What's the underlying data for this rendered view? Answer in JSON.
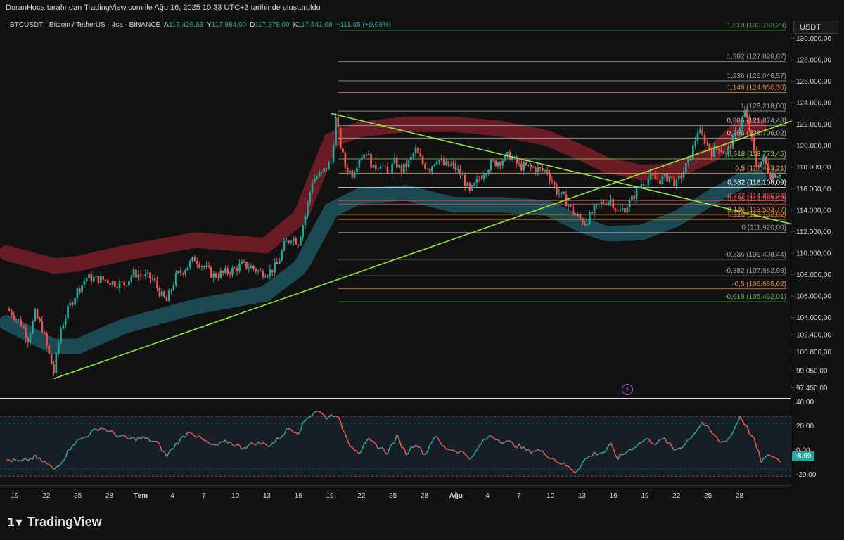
{
  "caption": "DuranHoca tarafından TradingView.com ile Ağu 16, 2025 10:33 UTC+3 tarihinde oluşturuldu",
  "legend": {
    "symbol": "BTCUSDT · Bitcoin / TetherUS · 4sa · BINANCE",
    "o_label": "A",
    "o_value": "117.429,63",
    "h_label": "Y",
    "h_value": "117.884,00",
    "l_label": "D",
    "l_value": "117.278,00",
    "c_label": "K",
    "c_value": "117.541,08",
    "change": "+111,45 (+0,09%)"
  },
  "currency": "USDT",
  "brand": "TradingView",
  "colors": {
    "up": "#26a69a",
    "down": "#ef5350",
    "trend": "#8fe63a",
    "band_upper": "#7a1f28",
    "band_lower": "#1f5560",
    "osc_line": "#26a69a"
  },
  "chart_data": [
    {
      "type": "candlestick",
      "symbol": "BTCUSDT",
      "timeframe": "4sa",
      "ylim": [
        96500,
        132000
      ],
      "y_ticks": [
        "130.000,00",
        "128.000,00",
        "126.000,00",
        "124.000,00",
        "122.000,00",
        "120.000,00",
        "118.000,00",
        "116.000,00",
        "114.000,00",
        "112.000,00",
        "110.000,00",
        "108.000,00",
        "106.000,00",
        "104.000,00",
        "102.400,00",
        "100.800,00",
        "99.050,00",
        "97.450,00"
      ],
      "y_tick_values": [
        130000,
        128000,
        126000,
        124000,
        122000,
        120000,
        118000,
        116000,
        114000,
        112000,
        110000,
        108000,
        106000,
        104000,
        102400,
        100800,
        99050,
        97450
      ],
      "x_labels": [
        "19",
        "22",
        "25",
        "28",
        "Tem",
        "4",
        "7",
        "10",
        "13",
        "16",
        "19",
        "22",
        "25",
        "28",
        "Ağu",
        "4",
        "7",
        "10",
        "13",
        "16",
        "19",
        "22",
        "25",
        "28"
      ],
      "close_path": [
        [
          0,
          104800
        ],
        [
          3,
          104200
        ],
        [
          6,
          103400
        ],
        [
          9,
          102000
        ],
        [
          12,
          104300
        ],
        [
          15,
          103000
        ],
        [
          18,
          100500
        ],
        [
          20,
          98900
        ],
        [
          23,
          103000
        ],
        [
          26,
          104700
        ],
        [
          30,
          106500
        ],
        [
          34,
          107700
        ],
        [
          38,
          107600
        ],
        [
          42,
          107500
        ],
        [
          46,
          107200
        ],
        [
          50,
          107100
        ],
        [
          54,
          108100
        ],
        [
          58,
          107900
        ],
        [
          62,
          107600
        ],
        [
          66,
          106000
        ],
        [
          68,
          105500
        ],
        [
          72,
          107800
        ],
        [
          76,
          108600
        ],
        [
          80,
          109500
        ],
        [
          84,
          108700
        ],
        [
          88,
          107900
        ],
        [
          92,
          108100
        ],
        [
          96,
          108400
        ],
        [
          100,
          108900
        ],
        [
          104,
          108700
        ],
        [
          108,
          108200
        ],
        [
          112,
          108300
        ],
        [
          115,
          108900
        ],
        [
          118,
          110700
        ],
        [
          121,
          111500
        ],
        [
          124,
          111000
        ],
        [
          127,
          113500
        ],
        [
          130,
          116800
        ],
        [
          134,
          117400
        ],
        [
          138,
          118500
        ],
        [
          140,
          122500
        ],
        [
          142,
          120000
        ],
        [
          144,
          118000
        ],
        [
          147,
          117400
        ],
        [
          150,
          118900
        ],
        [
          153,
          119500
        ],
        [
          156,
          117800
        ],
        [
          159,
          118400
        ],
        [
          162,
          117300
        ],
        [
          165,
          118500
        ],
        [
          168,
          117700
        ],
        [
          171,
          118400
        ],
        [
          174,
          119600
        ],
        [
          177,
          118300
        ],
        [
          180,
          117900
        ],
        [
          183,
          118900
        ],
        [
          186,
          118200
        ],
        [
          190,
          118100
        ],
        [
          194,
          117100
        ],
        [
          197,
          115600
        ],
        [
          200,
          116600
        ],
        [
          203,
          117600
        ],
        [
          206,
          118300
        ],
        [
          210,
          118600
        ],
        [
          214,
          119100
        ],
        [
          218,
          118100
        ],
        [
          222,
          118000
        ],
        [
          226,
          117800
        ],
        [
          230,
          117600
        ],
        [
          234,
          115800
        ],
        [
          238,
          114800
        ],
        [
          242,
          113500
        ],
        [
          246,
          112800
        ],
        [
          250,
          114000
        ],
        [
          254,
          114800
        ],
        [
          257,
          115000
        ],
        [
          260,
          113800
        ],
        [
          263,
          114200
        ],
        [
          266,
          115000
        ],
        [
          270,
          116500
        ],
        [
          274,
          117000
        ],
        [
          278,
          116800
        ],
        [
          282,
          117100
        ],
        [
          285,
          116400
        ],
        [
          288,
          117600
        ],
        [
          291,
          119000
        ],
        [
          294,
          121400
        ],
        [
          297,
          120500
        ],
        [
          300,
          119400
        ],
        [
          303,
          119900
        ],
        [
          306,
          119200
        ],
        [
          309,
          120500
        ],
        [
          312,
          121900
        ],
        [
          314,
          123200
        ],
        [
          316,
          121500
        ],
        [
          319,
          118200
        ],
        [
          322,
          118700
        ],
        [
          325,
          117300
        ],
        [
          328,
          117400
        ],
        [
          329,
          117541
        ]
      ],
      "bars_total": 334,
      "fib_levels": [
        {
          "ratio": "1,618",
          "price": 130763.29,
          "text": "1,618 (130.763,29)",
          "color": "#4caf50"
        },
        {
          "ratio": "1,382",
          "price": 127828.87,
          "text": "1,382 (127.828,87)",
          "color": "#9e9e9e"
        },
        {
          "ratio": "1,236",
          "price": 126046.57,
          "text": "1,236 (126.046,57)",
          "color": "#9e9e9e"
        },
        {
          "ratio": "1,146",
          "price": 124960.3,
          "text": "1,146 (124.960,30)",
          "color": "#e8892c"
        },
        {
          "ratio": "1",
          "price": 123218.0,
          "text": "1 (123.218,00)",
          "color": "#9e9e9e"
        },
        {
          "ratio": "0,886",
          "price": 121874.48,
          "text": "0,886 (121.874,48)",
          "color": "#b0b0b0"
        },
        {
          "ratio": "0,786",
          "price": 120706.02,
          "text": "0,786 (120.706,02)",
          "color": "#b0b0b0"
        },
        {
          "ratio": "0,618",
          "price": 118773.45,
          "text": "0,618 (118.773,45)",
          "color": "#8bc34a"
        },
        {
          "ratio": "0,5",
          "price": 117433.21,
          "text": "0,5 (117.433,21)",
          "color": "#f0b030"
        },
        {
          "ratio": "0,382",
          "price": 116108.09,
          "text": "0,382 (116.108,09)",
          "color": "#ffffff"
        },
        {
          "ratio": "0,272",
          "price": 114886.34,
          "text": "0,272 (114.886,34)",
          "color": "#ef5350"
        },
        {
          "ratio": "0,236",
          "price": 114563.52,
          "text": "0,236 (114.563,52)",
          "color": "#ef5350"
        },
        {
          "ratio": "0,146",
          "price": 113593.77,
          "text": "0,146 (113.593,77)",
          "color": "#e8892c"
        },
        {
          "ratio": "0,118",
          "price": 113132.02,
          "text": "0,118 (113.132,02)",
          "color": "#e8892c"
        },
        {
          "ratio": "0",
          "price": 111920.0,
          "text": "0 (111.920,00)",
          "color": "#9e9e9e"
        },
        {
          "ratio": "-0,236",
          "price": 109408.44,
          "text": "-0,236 (109.408,44)",
          "color": "#9e9e9e"
        },
        {
          "ratio": "-0,382",
          "price": 107882.98,
          "text": "-0,382 (107.882,98)",
          "color": "#9e9e9e"
        },
        {
          "ratio": "-0,5",
          "price": 106665.62,
          "text": "-0,5 (106.665,62)",
          "color": "#e8892c"
        },
        {
          "ratio": "-0,618",
          "price": 105462.01,
          "text": "-0,618 (105.462,01)",
          "color": "#4caf50"
        }
      ],
      "fib_start_bar": 141,
      "trendlines": [
        {
          "name": "descending",
          "from": [
            138,
            123000
          ],
          "to": [
            334,
            112700
          ]
        },
        {
          "name": "ascending",
          "from": [
            20,
            98300
          ],
          "to": [
            334,
            122300
          ]
        }
      ],
      "bands": {
        "upper": [
          [
            0,
            110000
          ],
          [
            20,
            108800
          ],
          [
            30,
            109000
          ],
          [
            50,
            110000
          ],
          [
            80,
            111200
          ],
          [
            110,
            110700
          ],
          [
            125,
            113400
          ],
          [
            138,
            120500
          ],
          [
            150,
            121500
          ],
          [
            170,
            122000
          ],
          [
            190,
            122000
          ],
          [
            210,
            121600
          ],
          [
            230,
            120700
          ],
          [
            245,
            119300
          ],
          [
            255,
            118200
          ],
          [
            270,
            117500
          ],
          [
            285,
            117700
          ],
          [
            300,
            119200
          ],
          [
            312,
            121700
          ],
          [
            320,
            121800
          ]
        ],
        "lower": [
          [
            0,
            103500
          ],
          [
            20,
            101300
          ],
          [
            30,
            101300
          ],
          [
            50,
            103200
          ],
          [
            80,
            105000
          ],
          [
            110,
            106200
          ],
          [
            125,
            108700
          ],
          [
            138,
            114000
          ],
          [
            150,
            115300
          ],
          [
            170,
            115600
          ],
          [
            190,
            114500
          ],
          [
            210,
            114500
          ],
          [
            230,
            114200
          ],
          [
            245,
            112600
          ],
          [
            255,
            111800
          ],
          [
            270,
            111900
          ],
          [
            285,
            113200
          ],
          [
            300,
            115200
          ],
          [
            312,
            116700
          ],
          [
            320,
            117000
          ]
        ]
      }
    },
    {
      "type": "oscillator",
      "ylim": [
        -28,
        42
      ],
      "y_ticks": [
        "40,00",
        "20,00",
        "0,00",
        "-20,00"
      ],
      "y_tick_values": [
        40,
        20,
        0,
        -20
      ],
      "current_value": "-8,69",
      "values": [
        [
          0,
          -8
        ],
        [
          6,
          -10
        ],
        [
          12,
          -6
        ],
        [
          16,
          -10
        ],
        [
          20,
          -16
        ],
        [
          24,
          -8
        ],
        [
          28,
          5
        ],
        [
          34,
          12
        ],
        [
          40,
          19
        ],
        [
          46,
          13
        ],
        [
          52,
          9
        ],
        [
          58,
          10
        ],
        [
          64,
          6
        ],
        [
          68,
          -5
        ],
        [
          72,
          5
        ],
        [
          78,
          16
        ],
        [
          82,
          10
        ],
        [
          88,
          3
        ],
        [
          94,
          7
        ],
        [
          100,
          2
        ],
        [
          106,
          6
        ],
        [
          112,
          4
        ],
        [
          116,
          10
        ],
        [
          120,
          18
        ],
        [
          124,
          15
        ],
        [
          128,
          27
        ],
        [
          132,
          33
        ],
        [
          136,
          27
        ],
        [
          140,
          30
        ],
        [
          142,
          22
        ],
        [
          146,
          5
        ],
        [
          150,
          -2
        ],
        [
          154,
          8
        ],
        [
          158,
          3
        ],
        [
          162,
          -2
        ],
        [
          166,
          11
        ],
        [
          170,
          -3
        ],
        [
          174,
          6
        ],
        [
          178,
          -4
        ],
        [
          182,
          12
        ],
        [
          186,
          2
        ],
        [
          190,
          0
        ],
        [
          194,
          -2
        ],
        [
          198,
          -7
        ],
        [
          202,
          6
        ],
        [
          206,
          12
        ],
        [
          210,
          8
        ],
        [
          214,
          6
        ],
        [
          218,
          3
        ],
        [
          222,
          -1
        ],
        [
          226,
          0
        ],
        [
          230,
          -4
        ],
        [
          234,
          -9
        ],
        [
          238,
          -13
        ],
        [
          242,
          -18
        ],
        [
          246,
          -8
        ],
        [
          250,
          -3
        ],
        [
          254,
          -2
        ],
        [
          257,
          4
        ],
        [
          260,
          -7
        ],
        [
          264,
          -1
        ],
        [
          268,
          4
        ],
        [
          272,
          9
        ],
        [
          276,
          6
        ],
        [
          280,
          9
        ],
        [
          284,
          0
        ],
        [
          288,
          4
        ],
        [
          292,
          13
        ],
        [
          296,
          23
        ],
        [
          300,
          14
        ],
        [
          304,
          6
        ],
        [
          308,
          11
        ],
        [
          312,
          28
        ],
        [
          314,
          22
        ],
        [
          318,
          8
        ],
        [
          321,
          -9
        ],
        [
          325,
          -4
        ],
        [
          329,
          -9
        ]
      ]
    }
  ]
}
